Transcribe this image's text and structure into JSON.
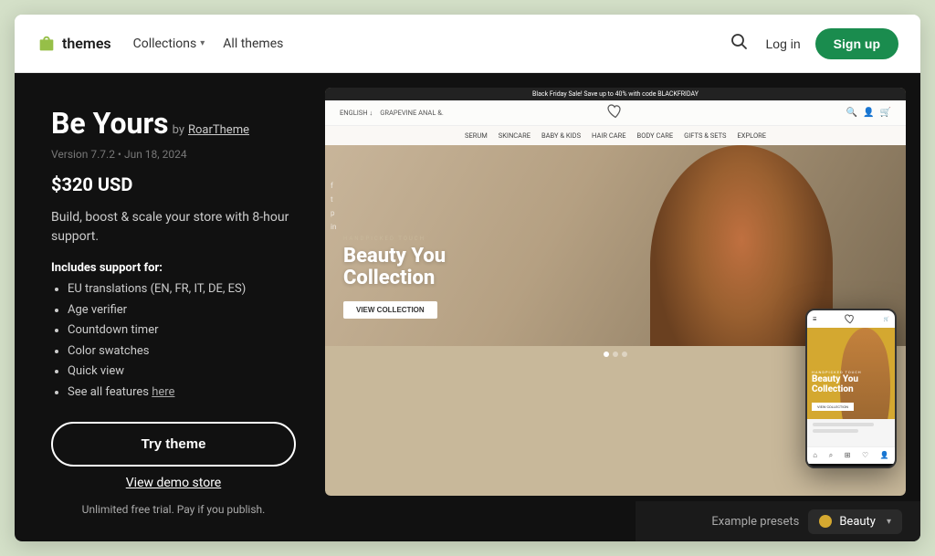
{
  "header": {
    "logo_text": "themes",
    "nav": {
      "collections_label": "Collections",
      "all_themes_label": "All themes"
    },
    "actions": {
      "login_label": "Log in",
      "signup_label": "Sign up"
    }
  },
  "theme": {
    "title": "Be Yours",
    "author_prefix": "by",
    "author_name": "RoarTheme",
    "version": "Version 7.7.2",
    "date": "Jun 18, 2024",
    "price": "$320 USD",
    "description": "Build, boost & scale your store with 8-hour support.",
    "includes_label": "Includes support for:",
    "features": [
      "EU translations (EN, FR, IT, DE, ES)",
      "Age verifier",
      "Countdown timer",
      "Color swatches",
      "Quick view",
      "See all features here"
    ],
    "try_button": "Try theme",
    "demo_link": "View demo store",
    "trial_text": "Unlimited free trial.",
    "trial_subtext": "Pay if you publish."
  },
  "preview": {
    "promo_bar": "Black Friday Sale! Save up to 40% with code BLACKFRIDAY",
    "store_nav_items": [
      "SERUM",
      "SKINCARE",
      "BABY & KIDS",
      "HAIR CARE",
      "BODY CARE",
      "GIFTS & SETS",
      "EXPLORE"
    ],
    "hero_eyebrow": "HANDPICKED TOUCH",
    "hero_heading_line1": "Beauty You",
    "hero_heading_line2": "Collection",
    "hero_cta": "VIEW COLLECTION",
    "social_icons": [
      "f",
      "t",
      "p",
      "in"
    ]
  },
  "bottom_bar": {
    "presets_label": "Example presets",
    "selected_preset": "Beauty",
    "preset_color": "#d4a830"
  }
}
